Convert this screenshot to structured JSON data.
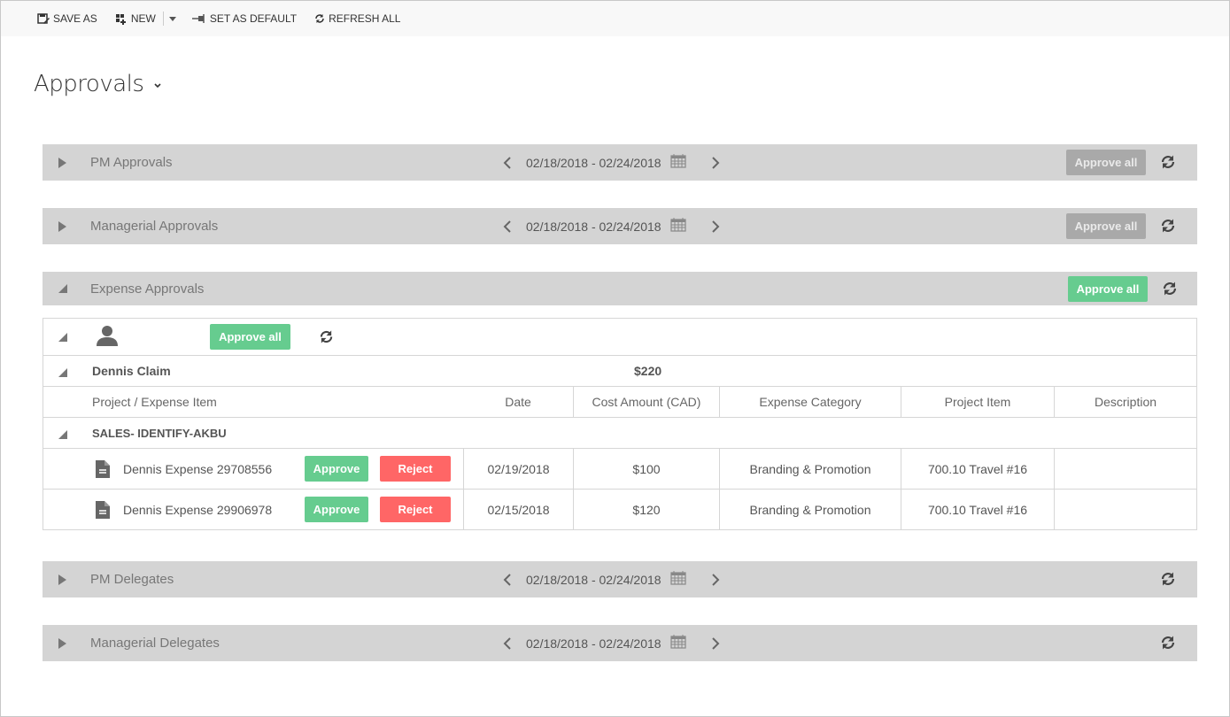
{
  "toolbar": {
    "save_as": "SAVE AS",
    "new": "NEW",
    "set_default": "SET AS DEFAULT",
    "refresh_all": "REFRESH ALL"
  },
  "page": {
    "title": "Approvals"
  },
  "sections": {
    "pm_approvals": {
      "title": "PM Approvals",
      "range": "02/18/2018 - 02/24/2018",
      "approve_all": "Approve all"
    },
    "managerial_approvals": {
      "title": "Managerial Approvals",
      "range": "02/18/2018 - 02/24/2018",
      "approve_all": "Approve all"
    },
    "expense_approvals": {
      "title": "Expense Approvals",
      "approve_all": "Approve all"
    },
    "pm_delegates": {
      "title": "PM Delegates",
      "range": "02/18/2018 - 02/24/2018"
    },
    "managerial_delegates": {
      "title": "Managerial Delegates",
      "range": "02/18/2018 - 02/24/2018"
    }
  },
  "expense": {
    "user_approve_all": "Approve all",
    "claim_name": "Dennis Claim",
    "claim_total": "$220",
    "columns": {
      "item": "Project / Expense Item",
      "date": "Date",
      "cost": "Cost Amount (CAD)",
      "category": "Expense Category",
      "project_item": "Project Item",
      "description": "Description"
    },
    "project": "SALES- IDENTIFY-AKBU",
    "approve_label": "Approve",
    "reject_label": "Reject",
    "items": [
      {
        "name": "Dennis Expense 29708556",
        "date": "02/19/2018",
        "cost": "$100",
        "category": "Branding & Promotion",
        "project_item": "700.10 Travel #16",
        "description": ""
      },
      {
        "name": "Dennis Expense 29906978",
        "date": "02/15/2018",
        "cost": "$120",
        "category": "Branding & Promotion",
        "project_item": "700.10 Travel #16",
        "description": ""
      }
    ]
  },
  "colors": {
    "bar_bg": "#d4d4d4",
    "approve_green": "#66cc8f",
    "reject_red": "#ff6666",
    "disabled_gray": "#a9a9a9"
  }
}
